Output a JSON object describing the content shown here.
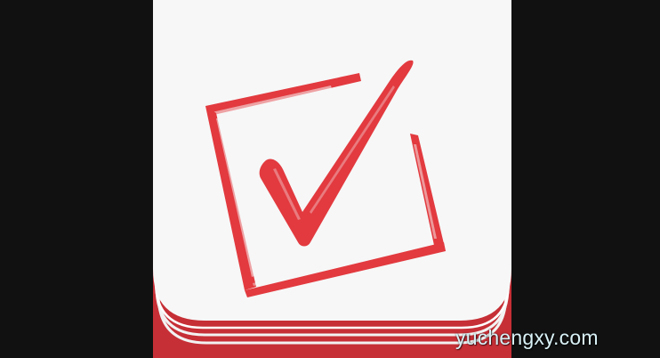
{
  "image": {
    "subject": "checklist-app-icon",
    "background_color": "#111111",
    "icon": {
      "card_color": "#f7f7f7",
      "base_color": "#c62f36",
      "accent_color": "#e23a3f",
      "symbol": "checkbox-checked-icon"
    },
    "watermark": {
      "text": "yuchengxy.com",
      "color": "#d9f1f6"
    }
  }
}
